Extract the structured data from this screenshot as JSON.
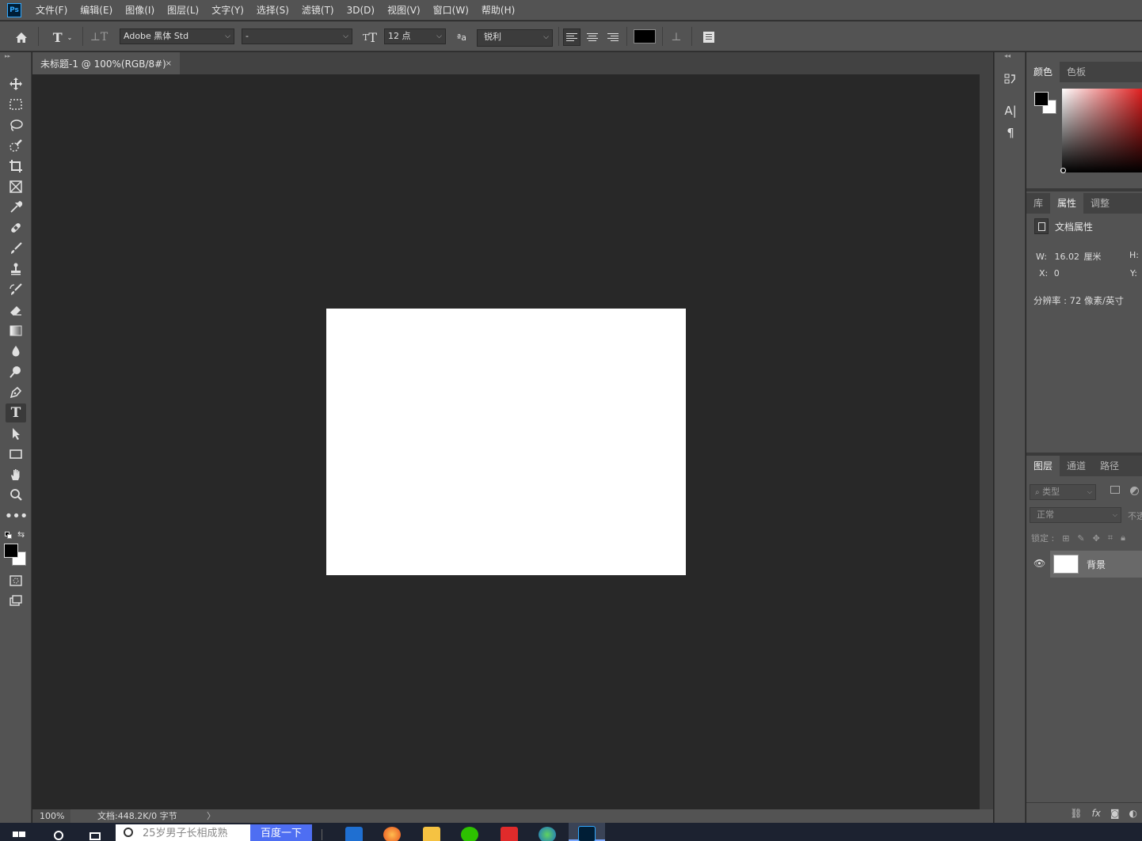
{
  "menubar": {
    "logo": "Ps",
    "items": [
      "文件(F)",
      "编辑(E)",
      "图像(I)",
      "图层(L)",
      "文字(Y)",
      "选择(S)",
      "滤镜(T)",
      "3D(D)",
      "视图(V)",
      "窗口(W)",
      "帮助(H)"
    ]
  },
  "options": {
    "font_family": "Adobe 黑体 Std",
    "font_style": "-",
    "font_size": "12 点",
    "aa_label": "ªa",
    "antialias": "锐利",
    "text_color": "#000000"
  },
  "document": {
    "tab_title": "未标题-1 @ 100%(RGB/8#)",
    "close_glyph": "×",
    "background": "#ffffff"
  },
  "status": {
    "zoom": "100%",
    "info": "文档:448.2K/0 字节",
    "arrow": "〉"
  },
  "panels": {
    "color_tabs": [
      "颜色",
      "色板"
    ],
    "color_tab_active": "颜色",
    "foreground": "#000000",
    "background": "#ffffff",
    "prop_tabs": [
      "库",
      "属性",
      "调整"
    ],
    "prop_tab_active": "属性",
    "prop_title": "文档属性",
    "width_label": "W:",
    "width_value": "16.02",
    "width_unit": "厘米",
    "height_label": "H:",
    "x_label": "X:",
    "x_value": "0",
    "y_label": "Y:",
    "resolution": "分辨率 : 72 像素/英寸",
    "layers_tabs": [
      "图层",
      "通道",
      "路径"
    ],
    "layers_tab_active": "图层",
    "filter_placeholder": "类型",
    "blend_mode": "正常",
    "opacity_label": "不透",
    "lock_label": "锁定 :",
    "layer_name": "背景",
    "footer_icons": [
      "link-icon",
      "fx-icon",
      "mask-icon",
      "adjustment-icon"
    ],
    "footer_fx": "fx"
  },
  "taskbar": {
    "search_placeholder": "25岁男子长相成熟",
    "search_button": "百度一下",
    "apps": [
      "ps-icon"
    ]
  }
}
